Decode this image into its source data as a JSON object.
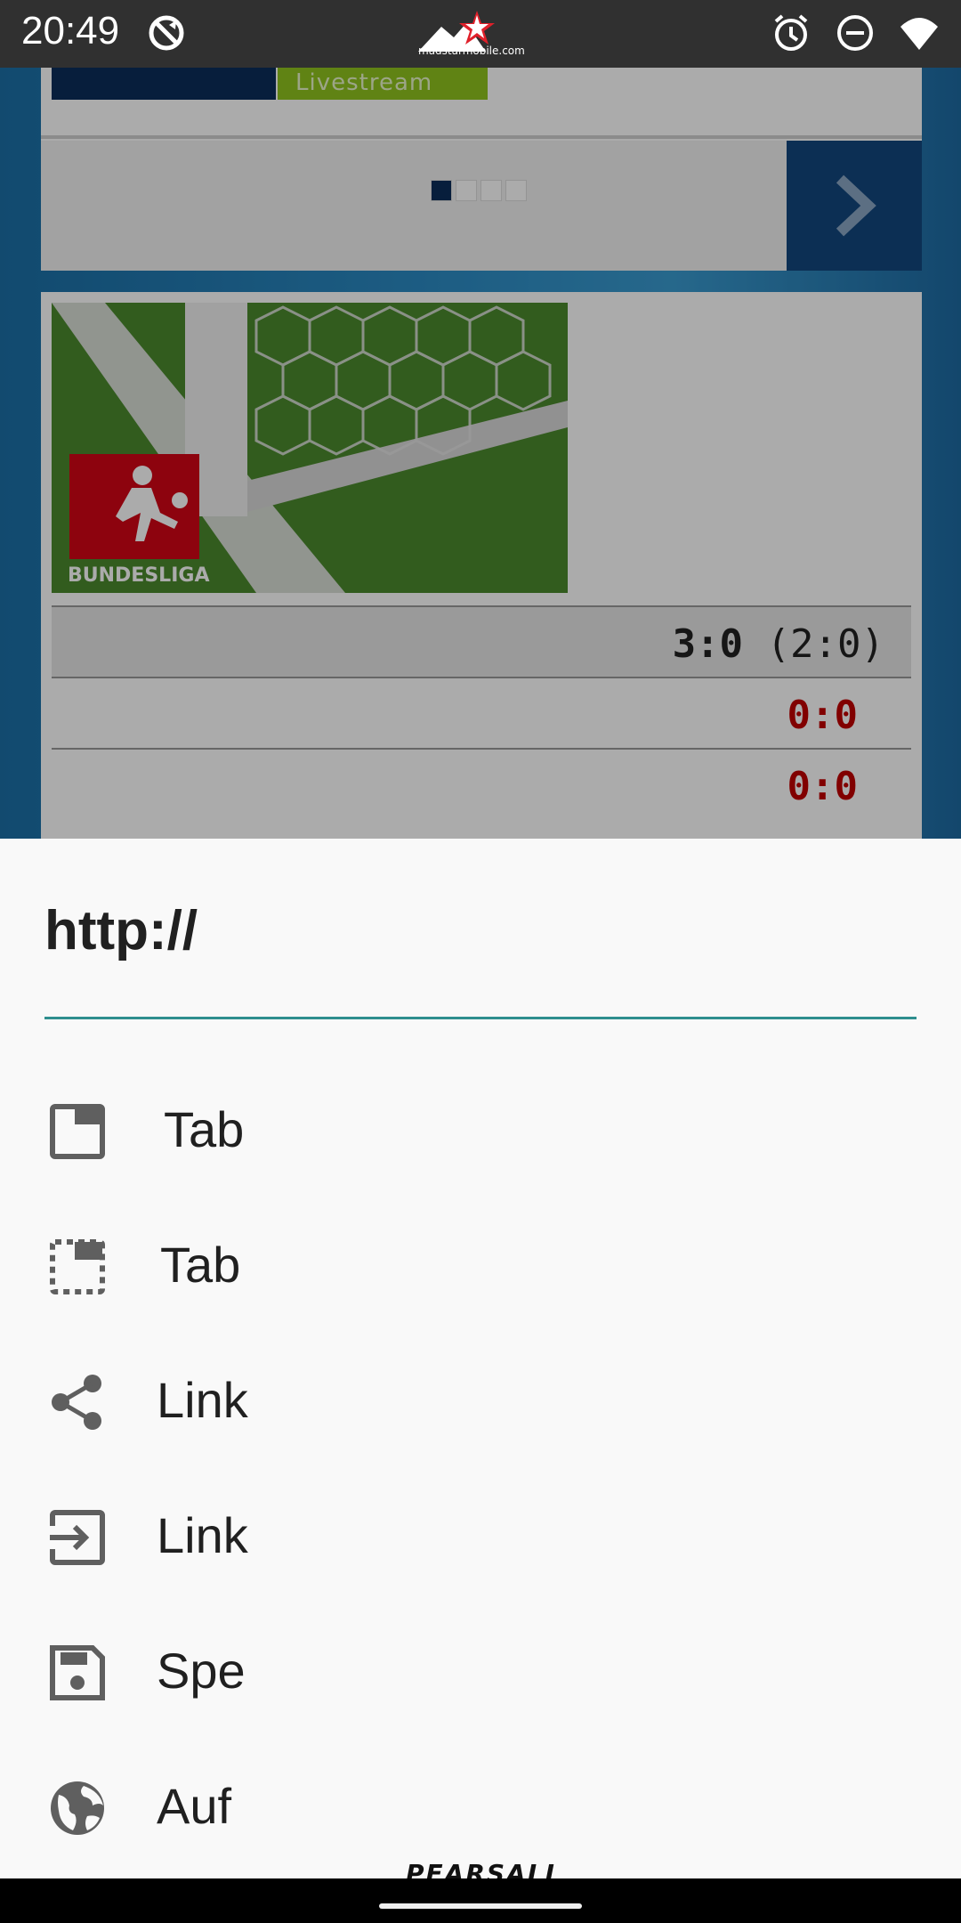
{
  "status_bar": {
    "time": "20:49",
    "icons": [
      "sync-disabled-icon",
      "alarm-icon",
      "do-not-disturb-icon",
      "wifi-icon"
    ],
    "logo_text": "madstarmobile.com"
  },
  "webpage": {
    "livestream_label": "Livestream",
    "carousel_pages": 4,
    "carousel_active": 1,
    "league_badge": "BUNDESLIGA",
    "scores": [
      {
        "main": "3:0",
        "half": "(2:0)"
      },
      {
        "main": "0:0"
      },
      {
        "main": "0:0"
      }
    ],
    "colors": {
      "badge_green": "#8fc31f",
      "score_red": "#c00000",
      "navy": "#12467e"
    }
  },
  "sheet": {
    "title": "http://",
    "items": [
      {
        "label": "Tab",
        "icon": "open-in-new-tab-icon"
      },
      {
        "label": "Tab",
        "icon": "open-in-incognito-tab-icon"
      },
      {
        "label": "Link",
        "icon": "share-icon"
      },
      {
        "label": "Link",
        "icon": "copy-link-icon"
      },
      {
        "label": "Spe",
        "icon": "save-icon"
      },
      {
        "label": "Auf",
        "icon": "globe-icon"
      }
    ],
    "accent_color": "#2f8f8f"
  },
  "watermark": "PEARSALL"
}
